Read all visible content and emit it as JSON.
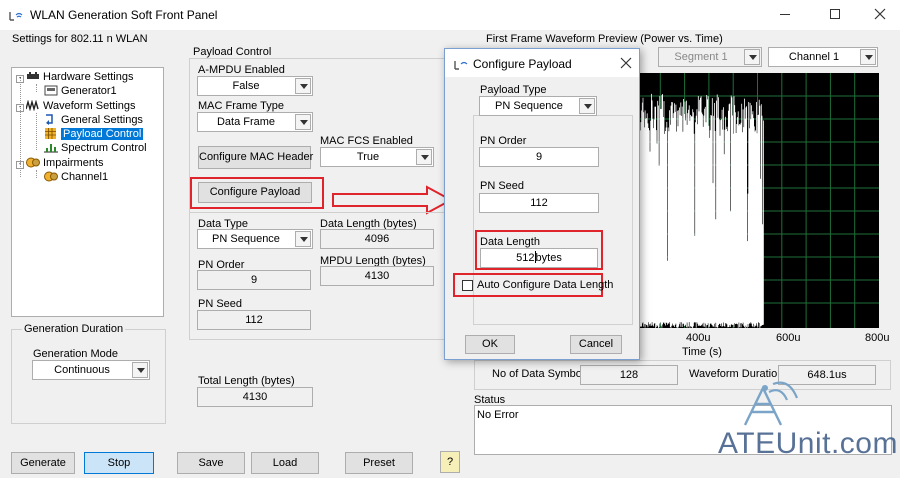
{
  "window": {
    "title": "WLAN Generation Soft Front Panel",
    "controls": [
      "minimize",
      "maximize",
      "close"
    ]
  },
  "settings": {
    "group_title": "Settings for 802.11 n WLAN",
    "tree": [
      {
        "label": "Hardware Settings",
        "icon": "hardware-icon"
      },
      {
        "label": "Generator1",
        "icon": "generator-icon"
      },
      {
        "label": "Waveform Settings",
        "icon": "waveform-icon"
      },
      {
        "label": "General Settings",
        "icon": "settings-arrow-icon"
      },
      {
        "label": "Payload Control",
        "icon": "grid-icon",
        "selected": true
      },
      {
        "label": "Spectrum Control",
        "icon": "spectrum-icon"
      },
      {
        "label": "Impairments",
        "icon": "impairments-icon"
      },
      {
        "label": "Channel1",
        "icon": "channel-icon"
      }
    ]
  },
  "generation_duration": {
    "title": "Generation Duration",
    "mode_label": "Generation Mode",
    "mode_value": "Continuous"
  },
  "payload_control": {
    "title": "Payload Control",
    "ampdu_label": "A-MPDU Enabled",
    "ampdu_value": "False",
    "mac_frame_type_label": "MAC Frame Type",
    "mac_frame_type_value": "Data Frame",
    "mac_fcs_label": "MAC FCS Enabled",
    "mac_fcs_value": "True",
    "configure_mac_header": "Configure MAC Header",
    "configure_payload": "Configure Payload",
    "data_type_label": "Data Type",
    "data_type_value": "PN Sequence",
    "data_length_label": "Data Length (bytes)",
    "data_length_value": "4096",
    "pn_order_label": "PN Order",
    "pn_order_value": "9",
    "mpdu_length_label": "MPDU Length (bytes)",
    "mpdu_length_value": "4130",
    "pn_seed_label": "PN Seed",
    "pn_seed_value": "112",
    "total_length_label": "Total Length (bytes)",
    "total_length_value": "4130"
  },
  "dialog": {
    "title": "Configure Payload",
    "payload_type_label": "Payload Type",
    "payload_type_value": "PN Sequence",
    "pn_order_label": "PN Order",
    "pn_order_value": "9",
    "pn_seed_label": "PN Seed",
    "pn_seed_value": "112",
    "data_length_label": "Data Length",
    "data_length_value": "512",
    "data_length_unit": "bytes",
    "auto_configure_label": "Auto Configure Data Length",
    "auto_configure_checked": false,
    "ok": "OK",
    "cancel": "Cancel"
  },
  "preview": {
    "title": "First Frame Waveform Preview (Power vs. Time)",
    "segment_value": "Segment 1",
    "channel_value": "Channel 1",
    "x_ticks": [
      "400u",
      "600u",
      "800u"
    ],
    "x_label": "Time (s)",
    "num_data_symbols_label": "No of Data Symbols",
    "num_data_symbols_value": "128",
    "waveform_duration_label": "Waveform Duration",
    "waveform_duration_value": "648.1us"
  },
  "status": {
    "title": "Status",
    "text": "No Error"
  },
  "buttons": {
    "generate": "Generate",
    "stop": "Stop",
    "save": "Save",
    "load": "Load",
    "preset": "Preset",
    "help": "?"
  },
  "watermark": "ATEUnit.com",
  "colors": {
    "selection": "#0078d7",
    "highlight_red": "#e0242c",
    "plot_bg": "#000000",
    "plot_grid": "#1f6f3a",
    "dialog_accent": "#0078d7"
  }
}
